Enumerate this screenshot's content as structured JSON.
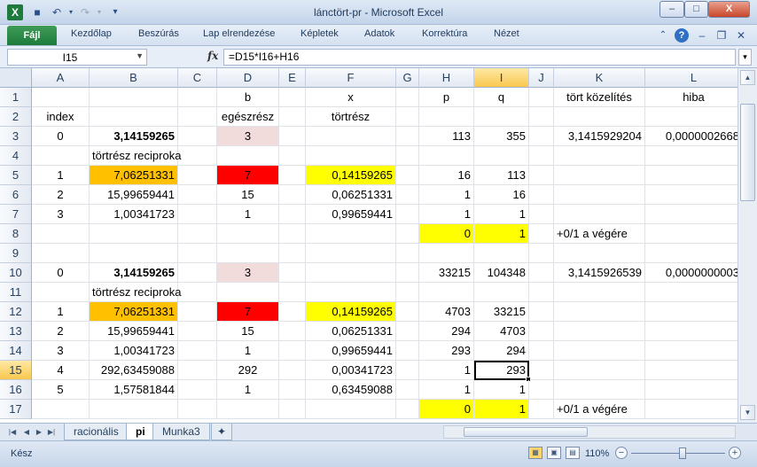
{
  "window": {
    "title": "lánctört-pr  -  Microsoft Excel",
    "min_label": "–",
    "max_label": "□",
    "close_label": "X"
  },
  "ribbon": {
    "tabs": [
      "Fájl",
      "Kezdőlap",
      "Beszúrás",
      "Lap elrendezése",
      "Képletek",
      "Adatok",
      "Korrektúra",
      "Nézet"
    ]
  },
  "formula_bar": {
    "name_box": "I15",
    "fx": "fx",
    "formula": "=D15*I16+H16"
  },
  "grid": {
    "selected_cell": "I15",
    "columns": [
      {
        "id": "A",
        "w": 65
      },
      {
        "id": "B",
        "w": 100
      },
      {
        "id": "C",
        "w": 44
      },
      {
        "id": "D",
        "w": 70
      },
      {
        "id": "E",
        "w": 30
      },
      {
        "id": "F",
        "w": 102
      },
      {
        "id": "G",
        "w": 26
      },
      {
        "id": "H",
        "w": 62
      },
      {
        "id": "I",
        "w": 62
      },
      {
        "id": "J",
        "w": 28
      },
      {
        "id": "K",
        "w": 103
      },
      {
        "id": "L",
        "w": 110
      }
    ],
    "rows": [
      1,
      2,
      3,
      4,
      5,
      6,
      7,
      8,
      9,
      10,
      11,
      12,
      13,
      14,
      15,
      16,
      17
    ],
    "cells": [
      {
        "r": 1,
        "c": "D",
        "v": "b",
        "a": "c"
      },
      {
        "r": 1,
        "c": "F",
        "v": "x",
        "a": "c"
      },
      {
        "r": 1,
        "c": "H",
        "v": "p",
        "a": "c"
      },
      {
        "r": 1,
        "c": "I",
        "v": "q",
        "a": "c"
      },
      {
        "r": 1,
        "c": "K",
        "v": "tört közelítés",
        "a": "c"
      },
      {
        "r": 1,
        "c": "L",
        "v": "hiba",
        "a": "c"
      },
      {
        "r": 2,
        "c": "A",
        "v": "index",
        "a": "c"
      },
      {
        "r": 2,
        "c": "D",
        "v": "egészrész",
        "a": "c"
      },
      {
        "r": 2,
        "c": "F",
        "v": "törtrész",
        "a": "c"
      },
      {
        "r": 3,
        "c": "A",
        "v": "0",
        "a": "c"
      },
      {
        "r": 3,
        "c": "B",
        "v": "3,14159265",
        "a": "r",
        "b": true
      },
      {
        "r": 3,
        "c": "D",
        "v": "3",
        "a": "c",
        "bg": "pink"
      },
      {
        "r": 3,
        "c": "H",
        "v": "113",
        "a": "r"
      },
      {
        "r": 3,
        "c": "I",
        "v": "355",
        "a": "r"
      },
      {
        "r": 3,
        "c": "K",
        "v": "3,1415929204",
        "a": "r"
      },
      {
        "r": 3,
        "c": "L",
        "v": "0,0000002668",
        "a": "r"
      },
      {
        "r": 4,
        "c": "B",
        "v": "törtrész reciproka",
        "a": "l"
      },
      {
        "r": 5,
        "c": "A",
        "v": "1",
        "a": "c"
      },
      {
        "r": 5,
        "c": "B",
        "v": "7,06251331",
        "a": "r",
        "bg": "o"
      },
      {
        "r": 5,
        "c": "D",
        "v": "7",
        "a": "c",
        "bg": "red"
      },
      {
        "r": 5,
        "c": "F",
        "v": "0,14159265",
        "a": "r",
        "bg": "y"
      },
      {
        "r": 5,
        "c": "H",
        "v": "16",
        "a": "r"
      },
      {
        "r": 5,
        "c": "I",
        "v": "113",
        "a": "r"
      },
      {
        "r": 6,
        "c": "A",
        "v": "2",
        "a": "c"
      },
      {
        "r": 6,
        "c": "B",
        "v": "15,99659441",
        "a": "r"
      },
      {
        "r": 6,
        "c": "D",
        "v": "15",
        "a": "c"
      },
      {
        "r": 6,
        "c": "F",
        "v": "0,06251331",
        "a": "r"
      },
      {
        "r": 6,
        "c": "H",
        "v": "1",
        "a": "r"
      },
      {
        "r": 6,
        "c": "I",
        "v": "16",
        "a": "r"
      },
      {
        "r": 7,
        "c": "A",
        "v": "3",
        "a": "c"
      },
      {
        "r": 7,
        "c": "B",
        "v": "1,00341723",
        "a": "r"
      },
      {
        "r": 7,
        "c": "D",
        "v": "1",
        "a": "c"
      },
      {
        "r": 7,
        "c": "F",
        "v": "0,99659441",
        "a": "r"
      },
      {
        "r": 7,
        "c": "H",
        "v": "1",
        "a": "r"
      },
      {
        "r": 7,
        "c": "I",
        "v": "1",
        "a": "r"
      },
      {
        "r": 8,
        "c": "H",
        "v": "0",
        "a": "r",
        "bg": "y"
      },
      {
        "r": 8,
        "c": "I",
        "v": "1",
        "a": "r",
        "bg": "y"
      },
      {
        "r": 8,
        "c": "K",
        "v": "+0/1 a végére",
        "a": "l"
      },
      {
        "r": 10,
        "c": "A",
        "v": "0",
        "a": "c"
      },
      {
        "r": 10,
        "c": "B",
        "v": "3,14159265",
        "a": "r",
        "b": true
      },
      {
        "r": 10,
        "c": "D",
        "v": "3",
        "a": "c",
        "bg": "pink"
      },
      {
        "r": 10,
        "c": "H",
        "v": "33215",
        "a": "r"
      },
      {
        "r": 10,
        "c": "I",
        "v": "104348",
        "a": "r"
      },
      {
        "r": 10,
        "c": "K",
        "v": "3,1415926539",
        "a": "r"
      },
      {
        "r": 10,
        "c": "L",
        "v": "0,0000000003",
        "a": "r"
      },
      {
        "r": 11,
        "c": "B",
        "v": "törtrész reciproka",
        "a": "l"
      },
      {
        "r": 12,
        "c": "A",
        "v": "1",
        "a": "c"
      },
      {
        "r": 12,
        "c": "B",
        "v": "7,06251331",
        "a": "r",
        "bg": "o"
      },
      {
        "r": 12,
        "c": "D",
        "v": "7",
        "a": "c",
        "bg": "red"
      },
      {
        "r": 12,
        "c": "F",
        "v": "0,14159265",
        "a": "r",
        "bg": "y"
      },
      {
        "r": 12,
        "c": "H",
        "v": "4703",
        "a": "r"
      },
      {
        "r": 12,
        "c": "I",
        "v": "33215",
        "a": "r"
      },
      {
        "r": 13,
        "c": "A",
        "v": "2",
        "a": "c"
      },
      {
        "r": 13,
        "c": "B",
        "v": "15,99659441",
        "a": "r"
      },
      {
        "r": 13,
        "c": "D",
        "v": "15",
        "a": "c"
      },
      {
        "r": 13,
        "c": "F",
        "v": "0,06251331",
        "a": "r"
      },
      {
        "r": 13,
        "c": "H",
        "v": "294",
        "a": "r"
      },
      {
        "r": 13,
        "c": "I",
        "v": "4703",
        "a": "r"
      },
      {
        "r": 14,
        "c": "A",
        "v": "3",
        "a": "c"
      },
      {
        "r": 14,
        "c": "B",
        "v": "1,00341723",
        "a": "r"
      },
      {
        "r": 14,
        "c": "D",
        "v": "1",
        "a": "c"
      },
      {
        "r": 14,
        "c": "F",
        "v": "0,99659441",
        "a": "r"
      },
      {
        "r": 14,
        "c": "H",
        "v": "293",
        "a": "r"
      },
      {
        "r": 14,
        "c": "I",
        "v": "294",
        "a": "r"
      },
      {
        "r": 15,
        "c": "A",
        "v": "4",
        "a": "c"
      },
      {
        "r": 15,
        "c": "B",
        "v": "292,63459088",
        "a": "r"
      },
      {
        "r": 15,
        "c": "D",
        "v": "292",
        "a": "c"
      },
      {
        "r": 15,
        "c": "F",
        "v": "0,00341723",
        "a": "r"
      },
      {
        "r": 15,
        "c": "H",
        "v": "1",
        "a": "r"
      },
      {
        "r": 15,
        "c": "I",
        "v": "293",
        "a": "r"
      },
      {
        "r": 16,
        "c": "A",
        "v": "5",
        "a": "c"
      },
      {
        "r": 16,
        "c": "B",
        "v": "1,57581844",
        "a": "r"
      },
      {
        "r": 16,
        "c": "D",
        "v": "1",
        "a": "c"
      },
      {
        "r": 16,
        "c": "F",
        "v": "0,63459088",
        "a": "r"
      },
      {
        "r": 16,
        "c": "H",
        "v": "1",
        "a": "r"
      },
      {
        "r": 16,
        "c": "I",
        "v": "1",
        "a": "r"
      },
      {
        "r": 17,
        "c": "H",
        "v": "0",
        "a": "r",
        "bg": "y"
      },
      {
        "r": 17,
        "c": "I",
        "v": "1",
        "a": "r",
        "bg": "y"
      },
      {
        "r": 17,
        "c": "K",
        "v": "+0/1 a végére",
        "a": "l"
      }
    ]
  },
  "sheets": {
    "tabs": [
      {
        "label": "racionális",
        "active": false
      },
      {
        "label": "pi",
        "active": true
      },
      {
        "label": "Munka3",
        "active": false
      }
    ]
  },
  "status": {
    "ready": "Kész",
    "zoom": "110%",
    "zoom_level_fraction": 0.55
  },
  "colors": {
    "yellow": "#ffff00",
    "orange": "#ffc000",
    "red": "#ff0000",
    "pink": "#f2dcdb",
    "excel_green": "#1f7a3e"
  }
}
